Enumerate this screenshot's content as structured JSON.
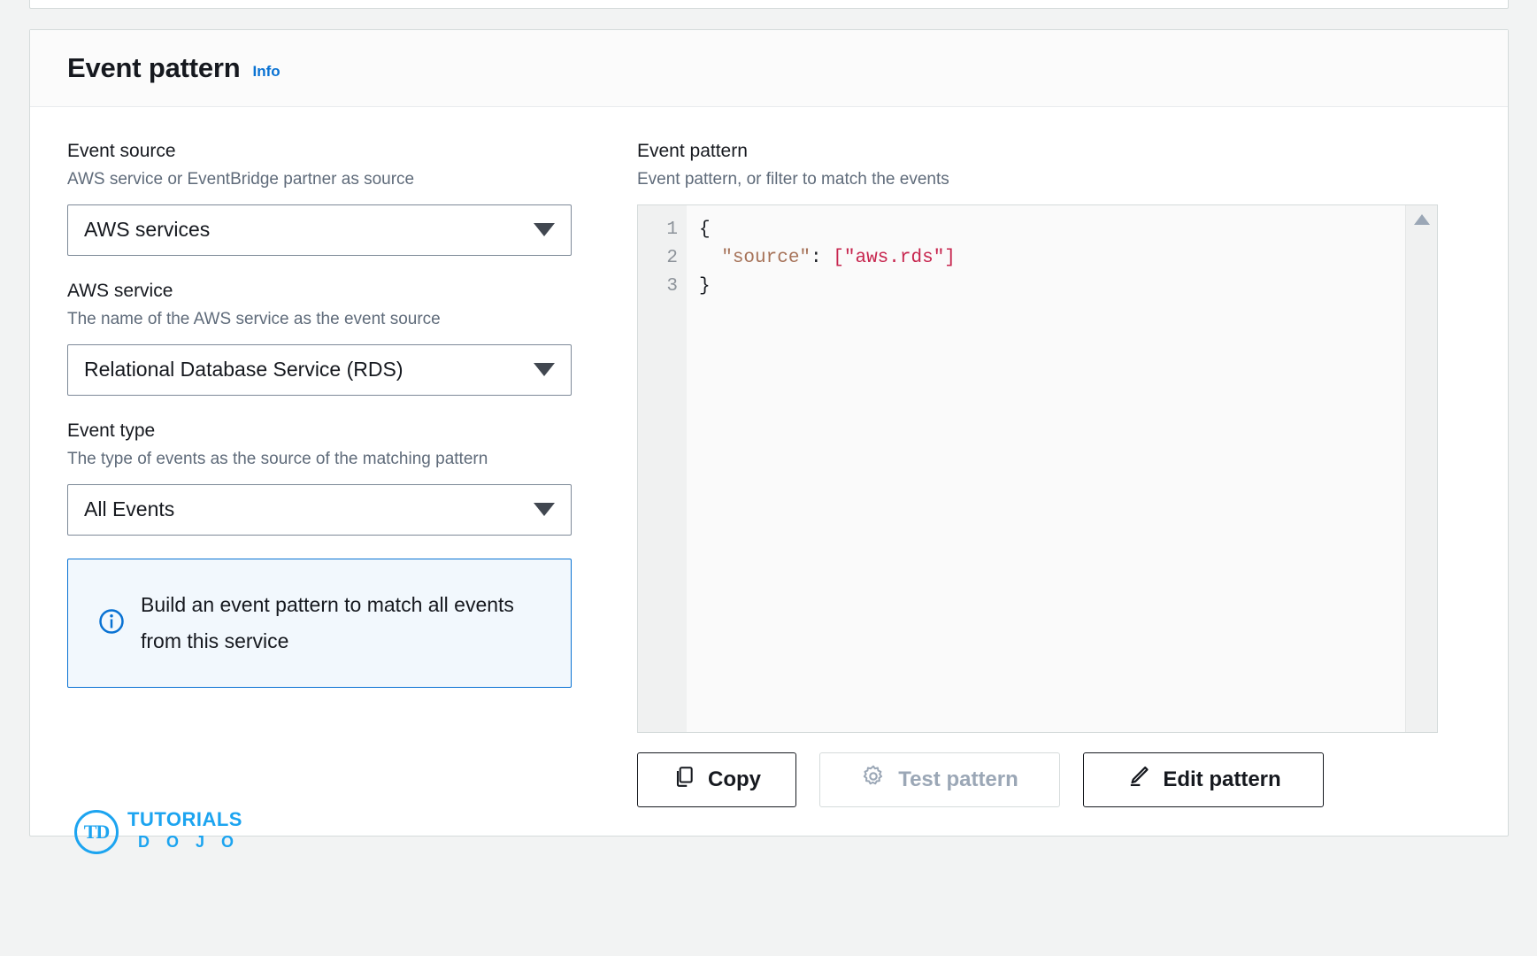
{
  "card": {
    "title": "Event pattern",
    "info_label": "Info"
  },
  "left": {
    "event_source": {
      "label": "Event source",
      "description": "AWS service or EventBridge partner as source",
      "value": "AWS services"
    },
    "aws_service": {
      "label": "AWS service",
      "description": "The name of the AWS service as the event source",
      "value": "Relational Database Service (RDS)"
    },
    "event_type": {
      "label": "Event type",
      "description": "The type of events as the source of the matching pattern",
      "value": "All Events"
    },
    "alert": {
      "icon": "info-circle-icon",
      "text": "Build an event pattern to match all events from this service"
    }
  },
  "right": {
    "label": "Event pattern",
    "description": "Event pattern, or filter to match the events",
    "editor": {
      "line_numbers": [
        "1",
        "2",
        "3"
      ],
      "lines": [
        {
          "indent": "",
          "punct_open": "{",
          "key": "",
          "colon": "",
          "bracket_open": "",
          "string": "",
          "bracket_close": "",
          "punct_close": ""
        },
        {
          "indent": "  ",
          "punct_open": "",
          "key": "\"source\"",
          "colon": ": ",
          "bracket_open": "[",
          "string": "\"aws.rds\"",
          "bracket_close": "]",
          "punct_close": ""
        },
        {
          "indent": "",
          "punct_open": "}",
          "key": "",
          "colon": "",
          "bracket_open": "",
          "string": "",
          "bracket_close": "",
          "punct_close": ""
        }
      ],
      "raw_text": "{\n  \"source\": [\"aws.rds\"]\n}"
    },
    "buttons": {
      "copy": {
        "label": "Copy",
        "icon": "copy-icon",
        "disabled": false
      },
      "test": {
        "label": "Test pattern",
        "icon": "gear-icon",
        "disabled": true
      },
      "edit": {
        "label": "Edit pattern",
        "icon": "pencil-icon",
        "disabled": false
      }
    }
  },
  "logo": {
    "mark": "TD",
    "top": "TUTORIALS",
    "bottom": "D O J O"
  },
  "colors": {
    "accent": "#0972d3",
    "alert_bg": "#f2f8fd",
    "text": "#16191f",
    "muted": "#5f6b7a",
    "brand": "#1ca4f0",
    "code_string": "#c7254e",
    "code_key": "#a67258"
  }
}
